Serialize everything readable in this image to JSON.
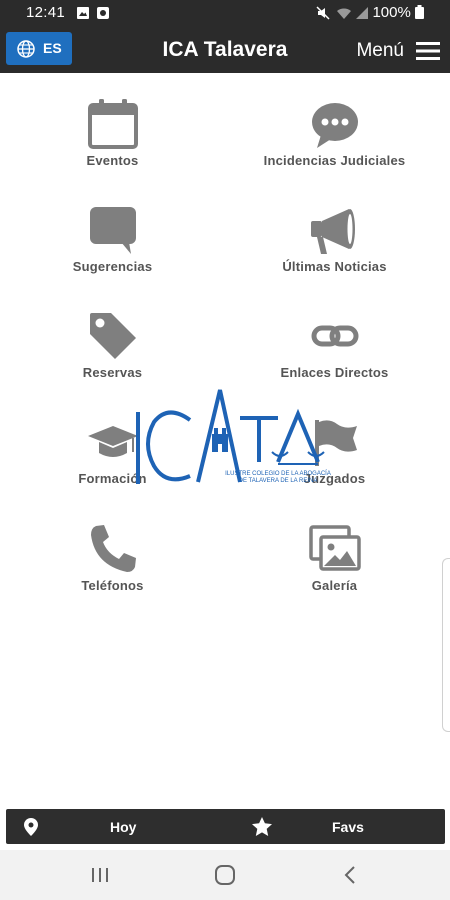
{
  "status": {
    "time": "12:41",
    "battery": "100%"
  },
  "appbar": {
    "lang": "ES",
    "title": "ICA Talavera",
    "menu_label": "Menú"
  },
  "grid": {
    "eventos": "Eventos",
    "incidencias": "Incidencias Judiciales",
    "sugerencias": "Sugerencias",
    "noticias": "Últimas Noticias",
    "reservas": "Reservas",
    "enlaces": "Enlaces Directos",
    "formacion": "Formación",
    "juzgados": "Juzgados",
    "telefonos": "Teléfonos",
    "galeria": "Galería"
  },
  "logo": {
    "text": "ICATA",
    "line1": "ILUSTRE COLEGIO DE LA ABOGACÍA",
    "line2": "DE TALAVERA DE LA REINA"
  },
  "bottom": {
    "hoy": "Hoy",
    "favs": "Favs"
  },
  "colors": {
    "bar": "#2b2b2b",
    "lang_button": "#1f6fbf",
    "icon": "#7f7f7f",
    "logo": "#1e63b5"
  }
}
